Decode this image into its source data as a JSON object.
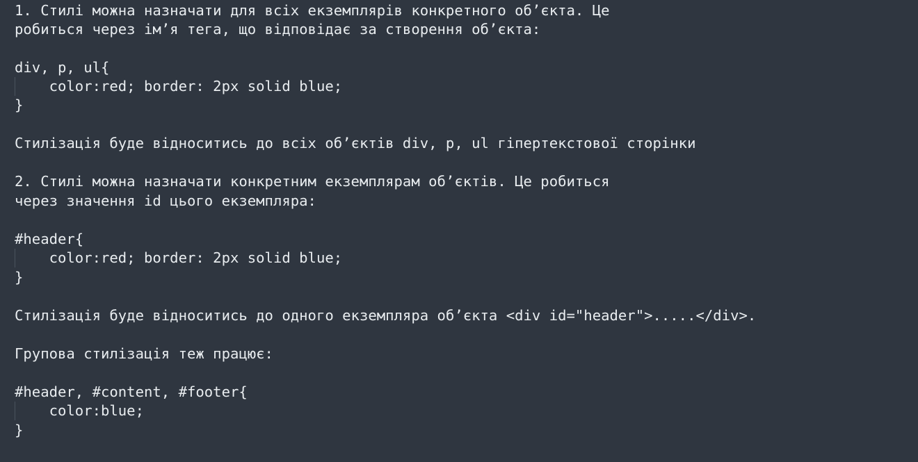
{
  "editor": {
    "background": "#2f3640",
    "text_color": "#e8ecef",
    "lines": [
      "1. Стилі можна назначати для всіх екземплярів конкретного об’єкта. Це",
      "робиться через ім’я тега, що відповідає за створення об’єкта:",
      "div, p, ul{",
      "    color:red; border: 2px solid blue;",
      "}",
      "Стилізація буде відноситись до всіх об’єктів div, p, ul гіпертекстової сторінки",
      "2. Стилі можна назначати конкретним екземплярам об’єктів. Це робиться",
      "через значення id цього екземпляра:",
      "#header{",
      "    color:red; border: 2px solid blue;",
      "}",
      "Стилізація буде відноситись до одного екземпляра об’єкта <div id=\"header\">.....</div>.",
      "Групова стилізація теж працює:",
      "#header, #content, #footer{",
      "    color:blue;",
      "}"
    ]
  }
}
